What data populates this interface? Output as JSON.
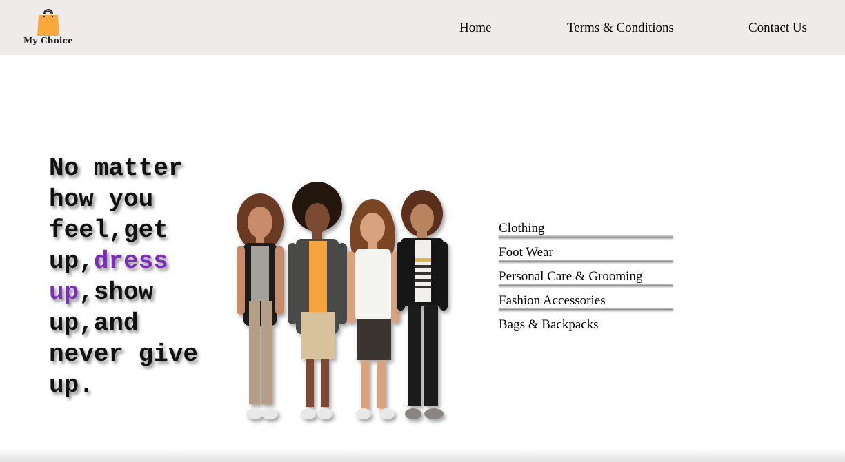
{
  "header": {
    "logo_text": "My Choice",
    "logo_icon": "shopping-bag-icon",
    "logo_color": "#f9a83a",
    "nav": [
      {
        "label": "Home"
      },
      {
        "label": "Terms & Conditions"
      },
      {
        "label": "Contact Us"
      }
    ]
  },
  "hero": {
    "tagline_part1": "No matter how you feel,get up,",
    "tagline_accent": "dress up",
    "tagline_part2": ",show up,and never give up.",
    "accent_color": "#7b2fb8",
    "image_alt": "kids-group-image"
  },
  "categories": [
    {
      "label": "Clothing"
    },
    {
      "label": "Foot Wear"
    },
    {
      "label": "Personal Care & Grooming"
    },
    {
      "label": "Fashion Accessories"
    },
    {
      "label": "Bags & Backpacks"
    }
  ]
}
